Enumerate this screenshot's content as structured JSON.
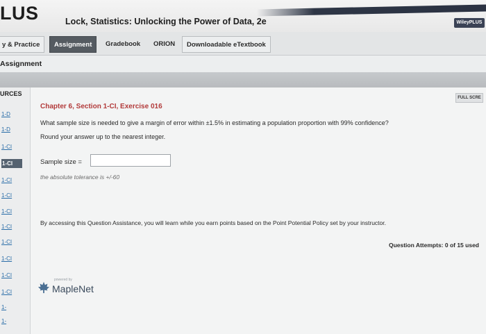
{
  "header": {
    "brand": "LUS",
    "book_title": "Lock, Statistics: Unlocking the Power of Data, 2e",
    "wiley_badge": "WileyPLUS"
  },
  "nav": {
    "tabs": [
      {
        "label": "y & Practice"
      },
      {
        "label": "Assignment"
      },
      {
        "label": "Gradebook"
      },
      {
        "label": "ORION"
      },
      {
        "label": "Downloadable eTextbook"
      }
    ]
  },
  "assignment_bar": {
    "label": "Assignment"
  },
  "sidebar": {
    "heading": "URCES",
    "items": [
      {
        "label": "1-D"
      },
      {
        "label": "1-D"
      },
      {
        "label": "1-CI"
      },
      {
        "label": "1-CI"
      },
      {
        "label": "1-CI"
      },
      {
        "label": "1-CI"
      },
      {
        "label": "1-CI"
      },
      {
        "label": "1-CI"
      },
      {
        "label": "1-CI"
      },
      {
        "label": "1-CI"
      },
      {
        "label": "1-CI"
      },
      {
        "label": "1-CI"
      },
      {
        "label": "1-"
      },
      {
        "label": "1-"
      }
    ]
  },
  "main": {
    "full_screen": "FULL SCRE",
    "exercise_title": "Chapter 6, Section 1-CI, Exercise 016",
    "question": "What sample size is needed to give a margin of error within ±1.5% in estimating a population proportion with 99% confidence?",
    "instruction": "Round your answer up to the nearest integer.",
    "sample_label": "Sample size =",
    "sample_value": "",
    "tolerance": "the absolute tolerance is +/-60",
    "assistance": "By accessing this Question Assistance, you will learn while you earn points based on the Point Potential Policy set by your instructor.",
    "attempts": "Question Attempts: 0 of 15 used",
    "maple_powered": "powered by",
    "maple_name": "MapleNet"
  },
  "colors": {
    "exercise_title": "#b23a3a",
    "active_tab": "#555b61",
    "link": "#2a6da8"
  }
}
